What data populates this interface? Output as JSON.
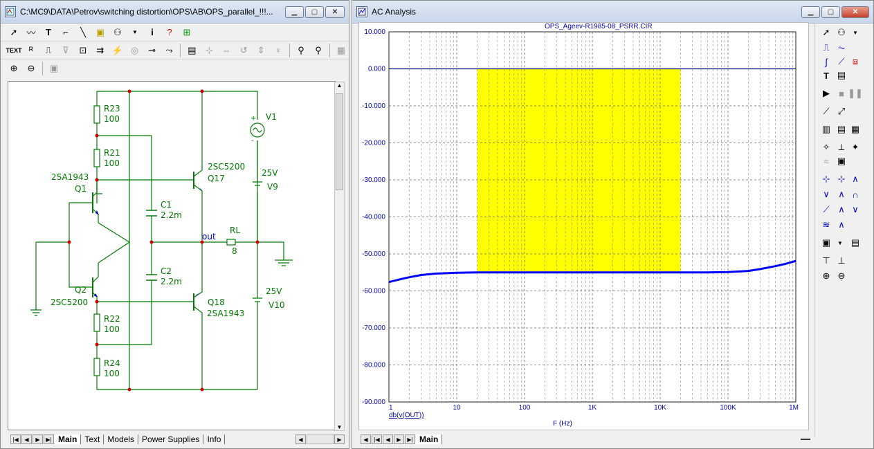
{
  "left_window": {
    "title": "C:\\MC9\\DATA\\Petrov\\switching distortion\\OPS\\AB\\OPS_parallel_!!!...",
    "toolbar_text_label": "TEXT",
    "tabs": [
      "Main",
      "Text",
      "Models",
      "Power Supplies",
      "Info"
    ],
    "active_tab": "Main",
    "schematic": {
      "R23": {
        "name": "R23",
        "value": "100"
      },
      "R21": {
        "name": "R21",
        "value": "100"
      },
      "R22": {
        "name": "R22",
        "value": "100"
      },
      "R24": {
        "name": "R24",
        "value": "100"
      },
      "Q1": {
        "name": "Q1",
        "model": "2SA1943"
      },
      "Q2": {
        "name": "Q2",
        "model": "2SC5200"
      },
      "Q17": {
        "name": "Q17",
        "model": "2SC5200"
      },
      "Q18": {
        "name": "Q18",
        "model": "2SA1943"
      },
      "C1": {
        "name": "C1",
        "value": "2.2m"
      },
      "C2": {
        "name": "C2",
        "value": "2.2m"
      },
      "V1": {
        "name": "V1",
        "plus": "+",
        "minus": "-"
      },
      "V9": {
        "name": "V9",
        "value": "25V"
      },
      "V10": {
        "name": "V10",
        "value": "25V"
      },
      "RL": {
        "name": "RL",
        "value": "8"
      },
      "net_out": "out"
    }
  },
  "right_window": {
    "title": "AC Analysis",
    "tabs": [
      "Main"
    ],
    "active_tab": "Main",
    "chart_title": "OPS_Ageev-R1985-08_PSRR.CIR",
    "trace_label": "db(v(OUT))",
    "x_axis_label": "F (Hz)"
  },
  "chart_data": {
    "type": "line",
    "title": "OPS_Ageev-R1985-08_PSRR.CIR",
    "xlabel": "F (Hz)",
    "ylabel": "",
    "x_scale": "log",
    "xlim": [
      1,
      1000000
    ],
    "ylim": [
      -90,
      10
    ],
    "x_ticks": [
      1,
      10,
      100,
      1000,
      10000,
      100000,
      1000000
    ],
    "x_tick_labels": [
      "1",
      "10",
      "100",
      "1K",
      "10K",
      "100K",
      "1M"
    ],
    "y_ticks": [
      10,
      0,
      -10,
      -20,
      -30,
      -40,
      -50,
      -60,
      -70,
      -80,
      -90
    ],
    "y_tick_labels": [
      "10.000",
      "0.000",
      "-10.000",
      "-20.000",
      "-30.000",
      "-40.000",
      "-50.000",
      "-60.000",
      "-70.000",
      "-80.000",
      "-90.000"
    ],
    "grid": true,
    "highlight_band": {
      "x": [
        20,
        20000
      ],
      "y": [
        -55,
        0
      ],
      "color": "#ffff00"
    },
    "reference_line": {
      "y": 0,
      "color": "#00008b"
    },
    "series": [
      {
        "name": "db(v(OUT))",
        "color": "#0000ff",
        "x": [
          1,
          1.5,
          2,
          3,
          5,
          10,
          20,
          50,
          100,
          1000,
          10000,
          50000,
          100000,
          200000,
          300000,
          500000,
          700000,
          1000000
        ],
        "y": [
          -57.6,
          -56.8,
          -56.3,
          -55.7,
          -55.3,
          -55.1,
          -55.0,
          -55.0,
          -55.0,
          -55.0,
          -55.0,
          -55.0,
          -54.9,
          -54.6,
          -54.1,
          -53.3,
          -52.7,
          -51.9
        ]
      }
    ]
  },
  "colors": {
    "schematic": "#007a00",
    "dot": "#cc0000",
    "trace": "#0000ff",
    "axis_text": "#0000aa",
    "highlight": "#ffff00"
  }
}
